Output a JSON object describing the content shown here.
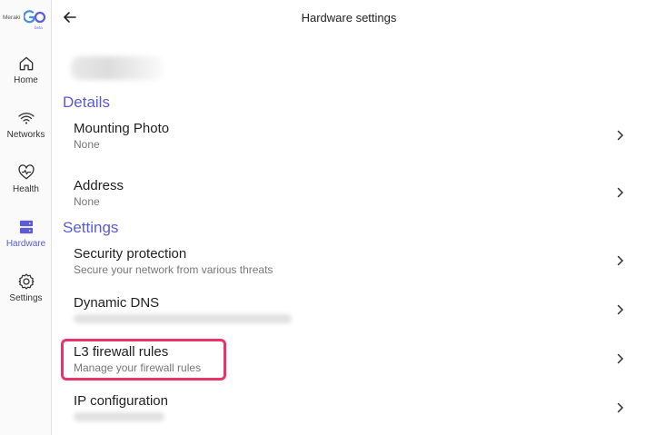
{
  "brand": {
    "name": "Meraki",
    "product_mark": "GO",
    "badge": "beta",
    "accent_color": "#5b5bd6",
    "highlight_color": "#e8336b"
  },
  "sidebar": {
    "items": [
      {
        "label": "Home",
        "icon": "home-icon",
        "active": false
      },
      {
        "label": "Networks",
        "icon": "wifi-icon",
        "active": false
      },
      {
        "label": "Health",
        "icon": "health-icon",
        "active": false
      },
      {
        "label": "Hardware",
        "icon": "hardware-icon",
        "active": true
      },
      {
        "label": "Settings",
        "icon": "gear-icon",
        "active": false
      }
    ]
  },
  "header": {
    "title": "Hardware settings",
    "back_icon": "arrow-left-icon"
  },
  "details": {
    "section_title": "Details",
    "rows": [
      {
        "title": "Mounting Photo",
        "subtitle": "None"
      },
      {
        "title": "Address",
        "subtitle": "None"
      }
    ]
  },
  "settings": {
    "section_title": "Settings",
    "rows": [
      {
        "title": "Security protection",
        "subtitle": "Secure your network from various threats"
      },
      {
        "title": "Dynamic DNS",
        "subtitle": ""
      },
      {
        "title": "L3 firewall rules",
        "subtitle": "Manage your firewall rules",
        "highlighted": true
      },
      {
        "title": "IP configuration",
        "subtitle": ""
      }
    ]
  }
}
